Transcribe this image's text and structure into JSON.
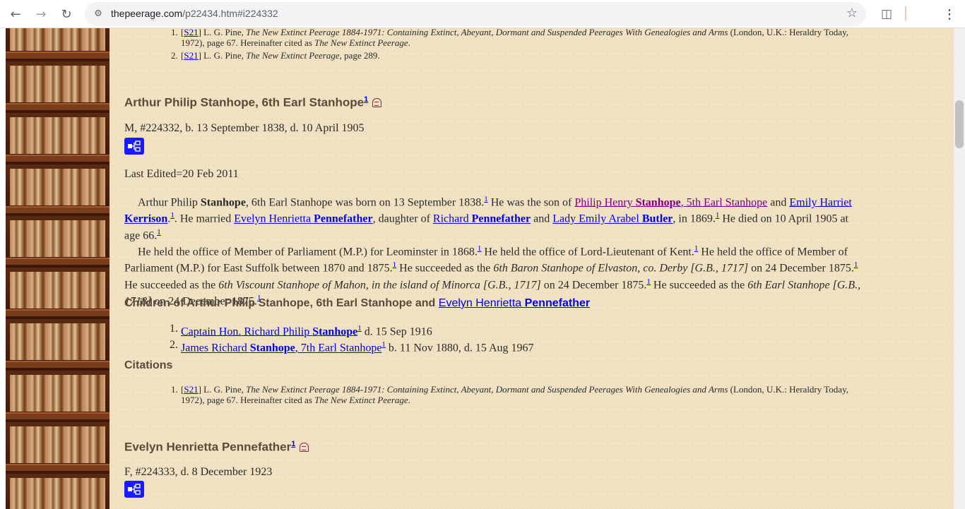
{
  "browser": {
    "url_host": "thepeerage.com",
    "url_path": "/p22434.htm#i224332"
  },
  "top_citations": [
    {
      "num": "1.",
      "src": "S21",
      "author": " L. G. Pine, ",
      "title": "The New Extinct Peerage 1884-1971: Containing Extinct, Abeyant, Dormant and Suspended Peerages With Genealogies and Arms",
      "rest": " (London, U.K.: Heraldry Today,",
      "line2": "1972), page 67. Hereinafter cited as ",
      "line2_title": "The New Extinct Peerage",
      "line2_end": "."
    },
    {
      "num": "2.",
      "src": "S21",
      "author": " L. G. Pine, ",
      "title": "The New Extinct Peerage",
      "rest": ", page 289."
    }
  ],
  "person1": {
    "name": "Arthur Philip Stanhope, 6th Earl Stanhope",
    "sup": "1",
    "meta": "M, #224332, b. 13 September 1838, d. 10 April 1905",
    "last_edited": "Last Edited=20 Feb 2011",
    "bio": {
      "p1_a": "Arthur Philip ",
      "p1_b": "Stanhope",
      "p1_c": ", 6th Earl Stanhope was born on 13 September 1838.",
      "p1_d": " He was the son of ",
      "father_a": "Philip Henry ",
      "father_b": "Stanhope",
      "father_c": ", 5th Earl Stanhope",
      "and": " and ",
      "mother_a": "Emily Harriet",
      "mother_b": "Kerrison",
      "p1_e": ". He married ",
      "wife_a": "Evelyn Henrietta ",
      "wife_b": "Pennefather",
      "p1_f": ", daughter of ",
      "wfather_a": "Richard ",
      "wfather_b": "Pennefather",
      "and2": " and ",
      "wmother_a": "Lady Emily Arabel ",
      "wmother_b": "Butler",
      "p1_g": ", in 1869.",
      "p1_h": " He died on 10 April 1905 at",
      "p1_i": "age 66.",
      "p2_a": "He held the office of Member of Parliament (M.P.) for Leominster in 1868.",
      "p2_b": " He held the office of Lord-Lieutenant of Kent.",
      "p2_c": " He held the office of Member of",
      "p2_d": "Parliament (M.P.) for East Suffolk between 1870 and 1875.",
      "p2_e": " He succeeded as the ",
      "p2_e_i": "6th Baron Stanhope of Elvaston, co. Derby [G.B., 1717]",
      "p2_f": " on 24 December 1875.",
      "p2_g": "He succeeded as the ",
      "p2_g_i": "6th Viscount Stanhope of Mahon, in the island of Minorca [G.B., 1717]",
      "p2_h": " on 24 December 1875.",
      "p2_i": " He succeeded as the ",
      "p2_i_i": "6th Earl Stanhope [G.B.,",
      "p2_j_i": "1718]",
      "p2_j": " on 24 December 1875."
    },
    "children_heading_a": "Children of Arthur Philip Stanhope, 6th Earl Stanhope and ",
    "children_heading_link_a": "Evelyn Henrietta ",
    "children_heading_link_b": "Pennefather",
    "children": [
      {
        "num": "1.",
        "link_a": "Captain Hon. Richard Philip ",
        "link_b": "Stanhope",
        "sup": "1",
        "rest": " d. 15 Sep 1916"
      },
      {
        "num": "2.",
        "link_a": "James Richard ",
        "link_b": "Stanhope",
        "link_c": ", 7th Earl Stanhope",
        "sup": "1",
        "rest": " b. 11 Nov 1880, d. 15 Aug 1967"
      }
    ],
    "citations_heading": "Citations",
    "citations": [
      {
        "num": "1.",
        "src": "S21",
        "author": " L. G. Pine, ",
        "title": "The New Extinct Peerage 1884-1971: Containing Extinct, Abeyant, Dormant and Suspended Peerages With Genealogies and Arms",
        "rest": " (London, U.K.: Heraldry Today,",
        "line2": "1972), page 67. Hereinafter cited as ",
        "line2_title": "The New Extinct Peerage",
        "line2_end": "."
      }
    ]
  },
  "person2": {
    "name": "Evelyn Henrietta Pennefather",
    "sup": "1",
    "meta": "F, #224333, d. 8 December 1923"
  },
  "sup1": "1"
}
